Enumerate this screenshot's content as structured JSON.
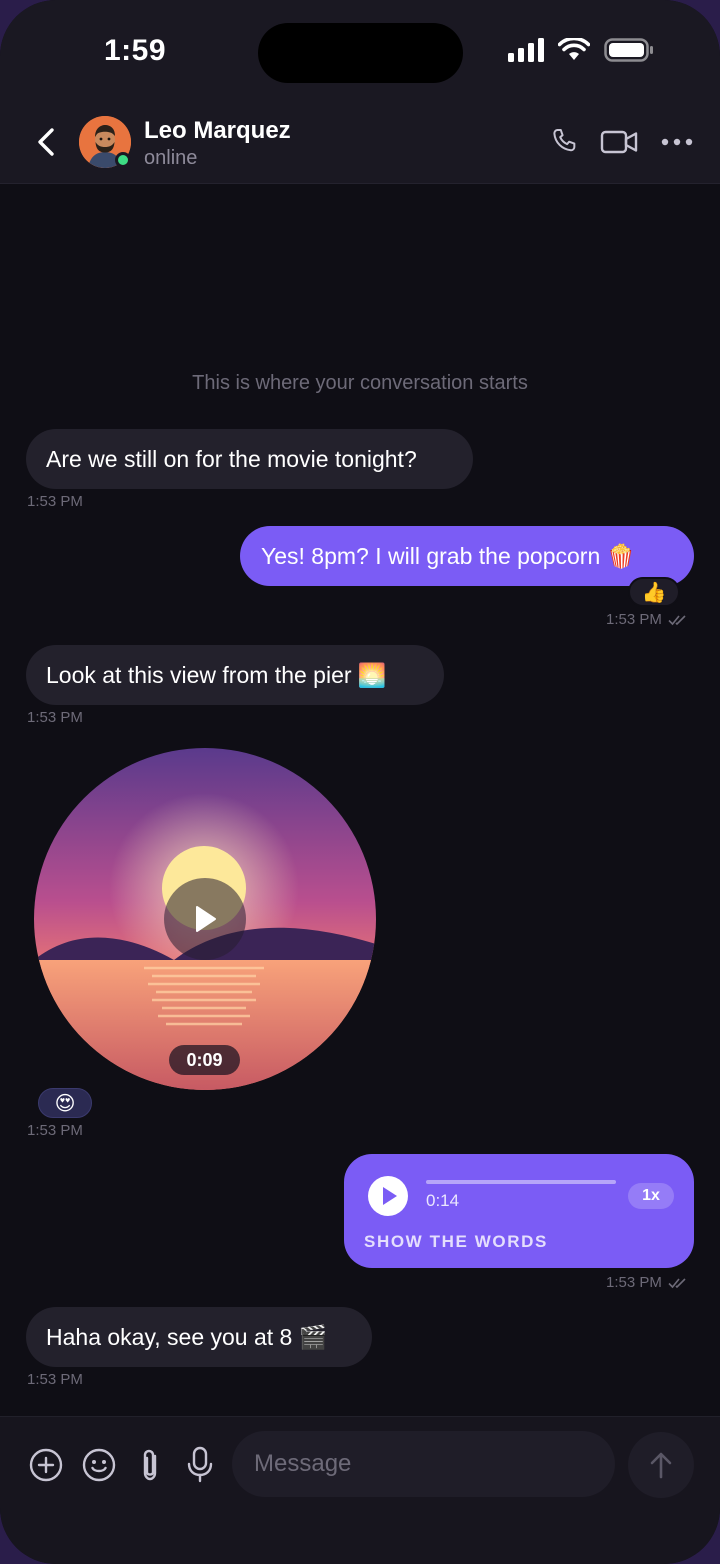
{
  "status_bar": {
    "time": "1:59"
  },
  "header": {
    "name": "Leo Marquez",
    "status": "online",
    "icons": [
      "back-icon",
      "phone-icon",
      "video-call-icon",
      "more-icon"
    ]
  },
  "chat": {
    "conversation_start": "This is where your conversation starts",
    "messages": [
      {
        "text": "Are we still on for the movie tonight?",
        "time": "1:53 PM",
        "direction": "in"
      },
      {
        "text": "Yes! 8pm? I will grab the popcorn 🍿",
        "time": "1:53 PM",
        "direction": "out",
        "reaction": "👍",
        "read": true
      },
      {
        "text": "Look at this view from the pier 🌅",
        "time": "1:53 PM",
        "direction": "in"
      },
      {
        "type": "video",
        "duration": "0:09",
        "reaction": "😍",
        "time": "1:53 PM",
        "direction": "in"
      },
      {
        "type": "voice",
        "duration": "0:14",
        "speed": "1x",
        "transcript_label": "SHOW THE WORDS",
        "time": "1:53 PM",
        "direction": "out",
        "read": true
      },
      {
        "text": "Haha okay, see you at 8 🎬",
        "time": "1:53 PM",
        "direction": "in"
      }
    ]
  },
  "composer": {
    "placeholder": "Message",
    "icons": [
      "add-icon",
      "emoji-icon",
      "attach-icon",
      "mic-icon",
      "send-icon"
    ]
  },
  "colors": {
    "background": "#0f0e15",
    "incoming_bubble": "#23212c",
    "outgoing_bubble": "#7b5cf5",
    "online": "#3ddc84"
  }
}
